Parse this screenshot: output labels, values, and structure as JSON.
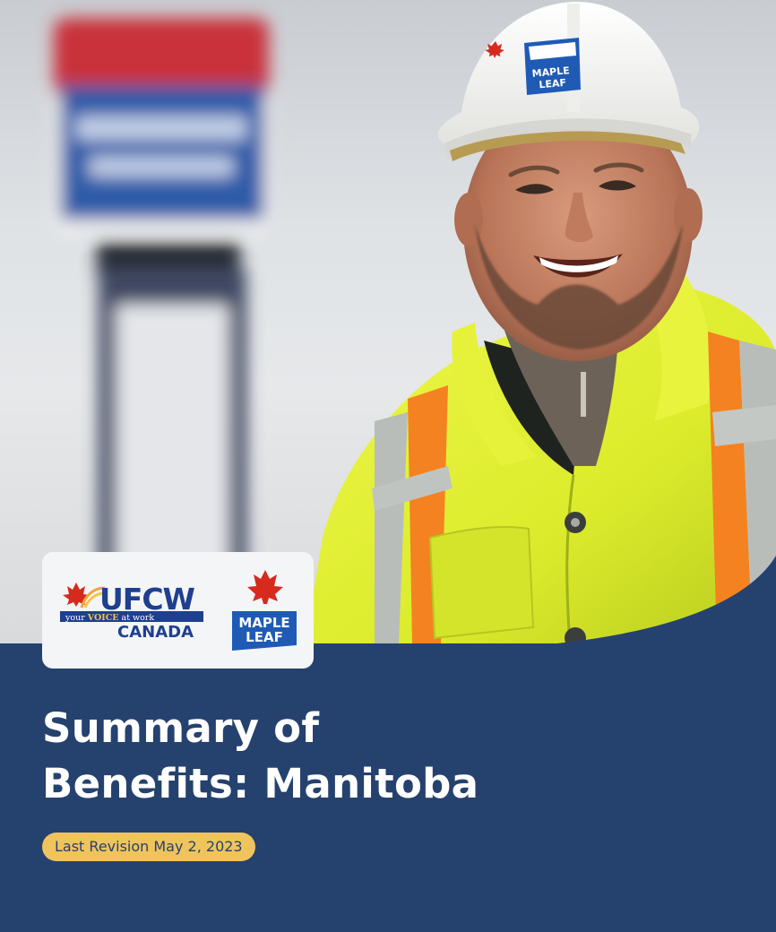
{
  "cover": {
    "title_line1": "Summary of",
    "title_line2": "Benefits: Manitoba",
    "revision": "Last Revision May 2, 2023"
  },
  "logos": {
    "ufcw": {
      "name": "UFCW",
      "tagline_prefix": "your ",
      "tagline_voice": "VOICE",
      "tagline_suffix": " at work",
      "country": "CANADA"
    },
    "maple_leaf": {
      "line1": "MAPLE",
      "line2": "LEAF"
    },
    "helmet_badge": {
      "line1": "MAPLE",
      "line2": "LEAF"
    }
  },
  "colors": {
    "navy": "#25426f",
    "badge_gold": "#f0c45c",
    "maple_red": "#d62a1f",
    "safety_yellow": "#e4f236",
    "safety_orange": "#f57f1e"
  }
}
